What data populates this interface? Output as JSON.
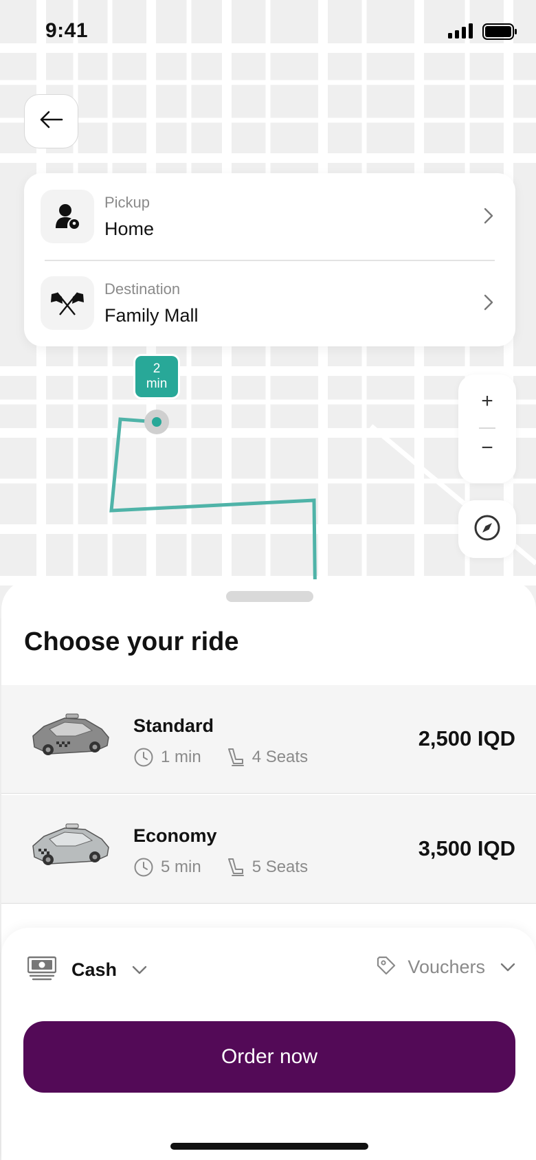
{
  "status_bar": {
    "time": "9:41",
    "signal_icon": "cellular-signal-icon",
    "battery_icon": "battery-icon"
  },
  "header": {
    "back_icon": "arrow-left-icon"
  },
  "route": {
    "pickup": {
      "label": "Pickup",
      "value": "Home",
      "icon": "person-pin-icon"
    },
    "destination": {
      "label": "Destination",
      "value": "Family Mall",
      "icon": "racing-flags-icon"
    }
  },
  "map": {
    "eta_badge": {
      "value": "2",
      "unit": "min"
    },
    "zoom_in": "+",
    "zoom_out": "−",
    "route_color": "#4fb3a8",
    "badge_color": "#28a898"
  },
  "sheet": {
    "title": "Choose your ride",
    "rides": [
      {
        "name": "Standard",
        "eta": "1 min",
        "seats": "4 Seats",
        "price": "2,500 IQD",
        "icon": "taxi-car-icon"
      },
      {
        "name": "Economy",
        "eta": "5 min",
        "seats": "5 Seats",
        "price": "3,500 IQD",
        "icon": "taxi-car-icon"
      }
    ]
  },
  "footer": {
    "payment": {
      "label": "Cash",
      "icon": "cash-icon"
    },
    "voucher": {
      "label": "Vouchers",
      "icon": "tag-icon"
    },
    "order_button": "Order now",
    "brand_color": "#530a57"
  }
}
